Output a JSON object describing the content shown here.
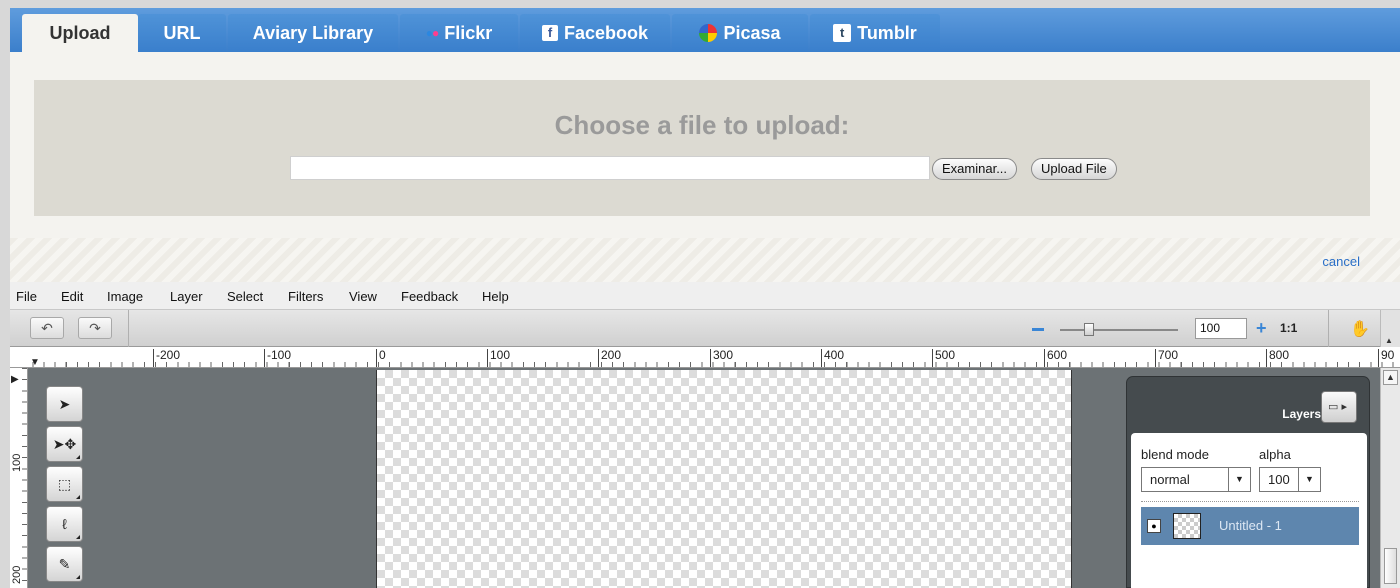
{
  "tabs": [
    {
      "label": "Upload",
      "active": true
    },
    {
      "label": "URL"
    },
    {
      "label": "Aviary Library"
    },
    {
      "label": "Flickr",
      "icon": "flickr-icon"
    },
    {
      "label": "Facebook",
      "icon": "facebook-icon",
      "glyph": "f"
    },
    {
      "label": "Picasa",
      "icon": "picasa-icon"
    },
    {
      "label": "Tumblr",
      "icon": "tumblr-icon",
      "glyph": "t"
    }
  ],
  "upload": {
    "title": "Choose a file to upload:",
    "file_value": "",
    "browse_label": "Examinar...",
    "upload_label": "Upload File",
    "cancel_label": "cancel"
  },
  "menu": [
    "File",
    "Edit",
    "Image",
    "Layer",
    "Select",
    "Filters",
    "View",
    "Feedback",
    "Help"
  ],
  "toolbar": {
    "undo_icon": "undo-icon",
    "redo_icon": "redo-icon",
    "zoom_value": "100",
    "zoom_level_fraction": 0.25,
    "actual_size_label": "1:1",
    "hand_icon": "hand-icon"
  },
  "ruler": {
    "h_labels": [
      "-200",
      "-100",
      "0",
      "100",
      "200",
      "300",
      "400",
      "500",
      "600",
      "700",
      "800",
      "90"
    ],
    "v_labels": [
      "100",
      "200"
    ]
  },
  "tools": [
    "select-arrow-icon",
    "move-icon",
    "marquee-icon",
    "lasso-icon",
    "magic-wand-icon"
  ],
  "layers": {
    "title": "Layers",
    "blend_label": "blend mode",
    "alpha_label": "alpha",
    "blend_value": "normal",
    "alpha_value": "100",
    "items": [
      {
        "name": "Untitled - 1",
        "visible": true,
        "selected": true
      }
    ]
  },
  "colors": {
    "tab_bar": "#3b7fcb",
    "layer_selected": "#5e86ae",
    "link": "#2a6fc7",
    "workspace": "#6c7275"
  }
}
